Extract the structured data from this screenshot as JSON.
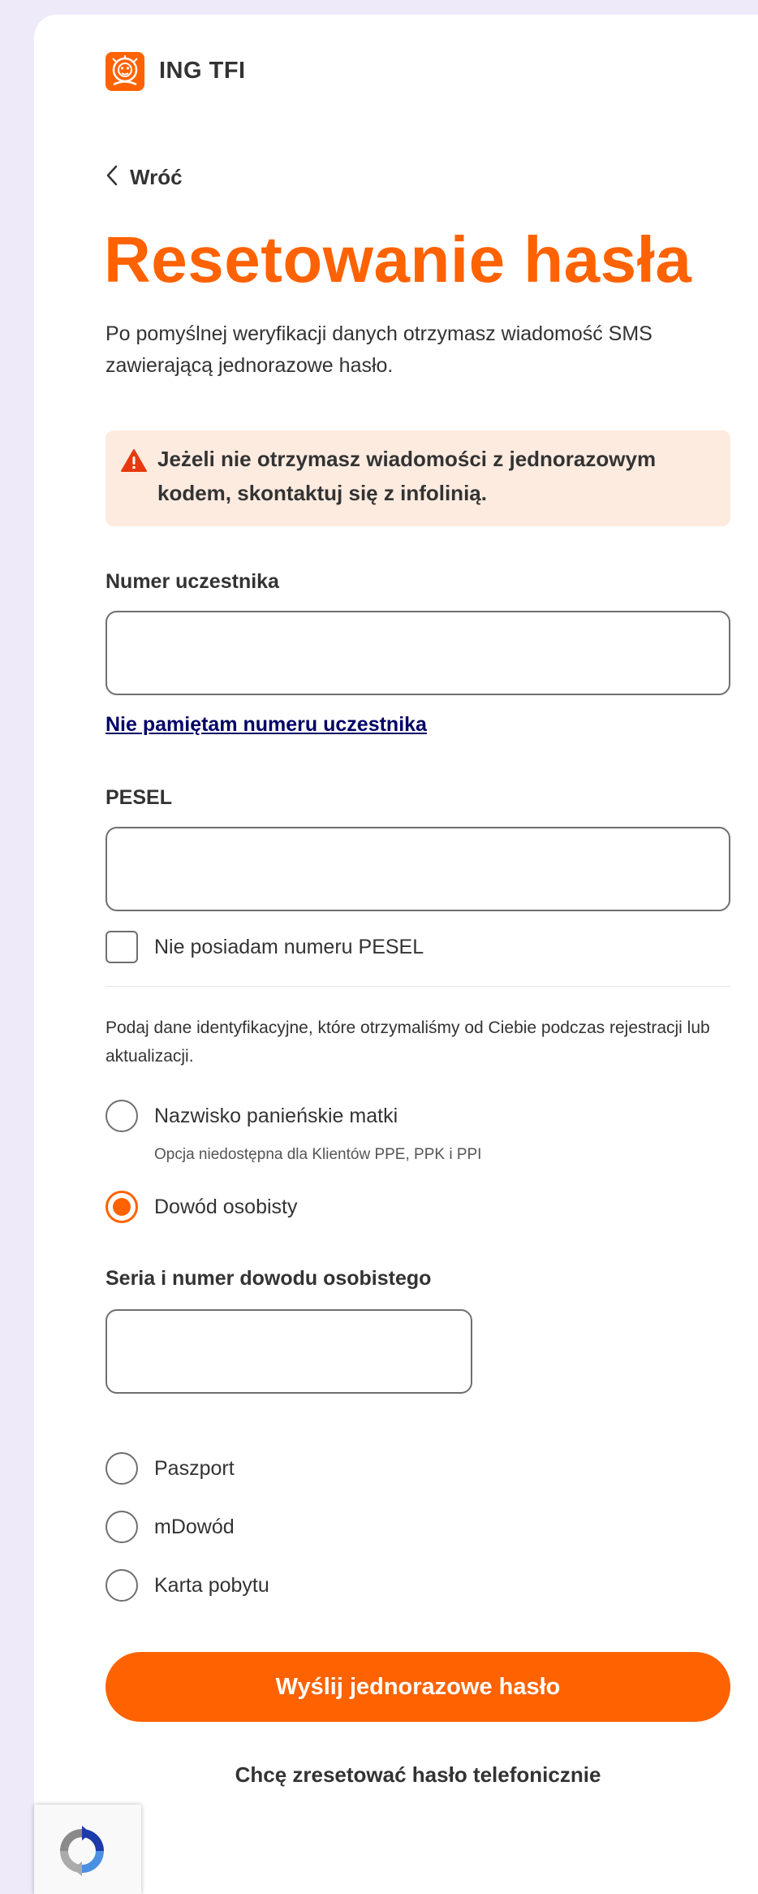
{
  "header": {
    "brand": "ING TFI",
    "logo_icon": "ing-lion-logo",
    "accent_color": "#ff6200"
  },
  "back": {
    "label": "Wróć",
    "icon": "chevron-left-icon"
  },
  "page": {
    "title": "Resetowanie hasła",
    "intro": "Po pomyślnej weryfikacji danych otrzymasz wiadomość SMS zawierającą jednorazowe hasło."
  },
  "alert": {
    "icon": "warning-triangle-icon",
    "text": "Jeżeli nie otrzymasz wiadomości z jednorazowym kodem, skontaktuj się z infolinią.",
    "background": "#fdebe0"
  },
  "form": {
    "participant_number": {
      "label": "Numer uczestnika",
      "value": "",
      "placeholder": ""
    },
    "forgot_link": "Nie pamiętam numeru uczestnika",
    "pesel": {
      "label": "PESEL",
      "value": "",
      "placeholder": ""
    },
    "no_pesel": {
      "label": "Nie posiadam numeru PESEL",
      "checked": false
    },
    "identity_hint": "Podaj dane identyfikacyjne, które otrzymaliśmy od Ciebie podczas rejestracji lub aktualizacji.",
    "options": {
      "maiden_name": {
        "label": "Nazwisko panieńskie matki",
        "sublabel": "Opcja niedostępna dla Klientów PPE, PPK i PPI",
        "selected": false
      },
      "id_card": {
        "label": "Dowód osobisty",
        "selected": true
      },
      "passport": {
        "label": "Paszport",
        "selected": false
      },
      "mdowod": {
        "label": "mDowód",
        "selected": false
      },
      "residence_card": {
        "label": "Karta pobytu",
        "selected": false
      }
    },
    "id_number": {
      "label": "Seria i numer dowodu osobistego",
      "value": "",
      "placeholder": ""
    },
    "submit_label": "Wyślij jednorazowe hasło",
    "phone_reset_label": "Chcę zresetować hasło telefonicznie"
  },
  "recaptcha": {
    "icon": "recaptcha-icon"
  }
}
